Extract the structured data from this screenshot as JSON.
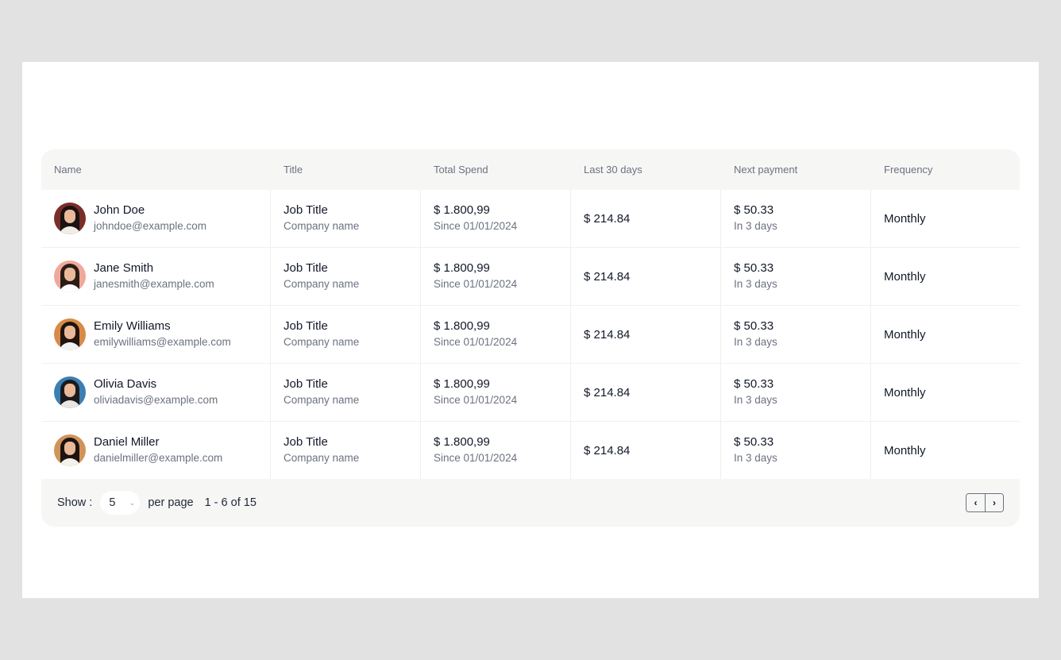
{
  "columns": [
    "Name",
    "Title",
    "Total Spend",
    "Last 30 days",
    "Next payment",
    "Frequency"
  ],
  "rows": [
    {
      "name": "John Doe",
      "email": "johndoe@example.com",
      "job": "Job Title",
      "company": "Company name",
      "total": "$ 1.800,99",
      "since": "Since 01/01/2024",
      "last30": "$ 214.84",
      "next": "$ 50.33",
      "due": "In 3 days",
      "frequency": "Monthly",
      "avatar": {
        "bg": "#7a2e2a",
        "hair": "#1b1212",
        "shirt": "#f3ece6"
      }
    },
    {
      "name": "Jane Smith",
      "email": "janesmith@example.com",
      "job": "Job Title",
      "company": "Company name",
      "total": "$ 1.800,99",
      "since": "Since 01/01/2024",
      "last30": "$ 214.84",
      "next": "$ 50.33",
      "due": "In 3 days",
      "frequency": "Monthly",
      "avatar": {
        "bg": "#f0a89a",
        "hair": "#2a1d17",
        "shirt": "#ffffff"
      }
    },
    {
      "name": "Emily Williams",
      "email": "emilywilliams@example.com",
      "job": "Job Title",
      "company": "Company name",
      "total": "$ 1.800,99",
      "since": "Since 01/01/2024",
      "last30": "$ 214.84",
      "next": "$ 50.33",
      "due": "In 3 days",
      "frequency": "Monthly",
      "avatar": {
        "bg": "#d98a47",
        "hair": "#21140e",
        "shirt": "#f2f2f2"
      }
    },
    {
      "name": "Olivia Davis",
      "email": "oliviadavis@example.com",
      "job": "Job Title",
      "company": "Company name",
      "total": "$ 1.800,99",
      "since": "Since 01/01/2024",
      "last30": "$ 214.84",
      "next": "$ 50.33",
      "due": "In 3 days",
      "frequency": "Monthly",
      "avatar": {
        "bg": "#3a7fb4",
        "hair": "#1a1a1d",
        "shirt": "#e9e5e0"
      }
    },
    {
      "name": "Daniel Miller",
      "email": "danielmiller@example.com",
      "job": "Job Title",
      "company": "Company name",
      "total": "$ 1.800,99",
      "since": "Since 01/01/2024",
      "last30": "$ 214.84",
      "next": "$ 50.33",
      "due": "In 3 days",
      "frequency": "Monthly",
      "avatar": {
        "bg": "#d2935a",
        "hair": "#1c1410",
        "shirt": "#f4f0ea"
      }
    }
  ],
  "footer": {
    "show_label": "Show :",
    "per_page_value": "5",
    "per_page_label": "per page",
    "range": "1 - 6 of 15",
    "prev_icon": "‹",
    "next_icon": "›"
  }
}
